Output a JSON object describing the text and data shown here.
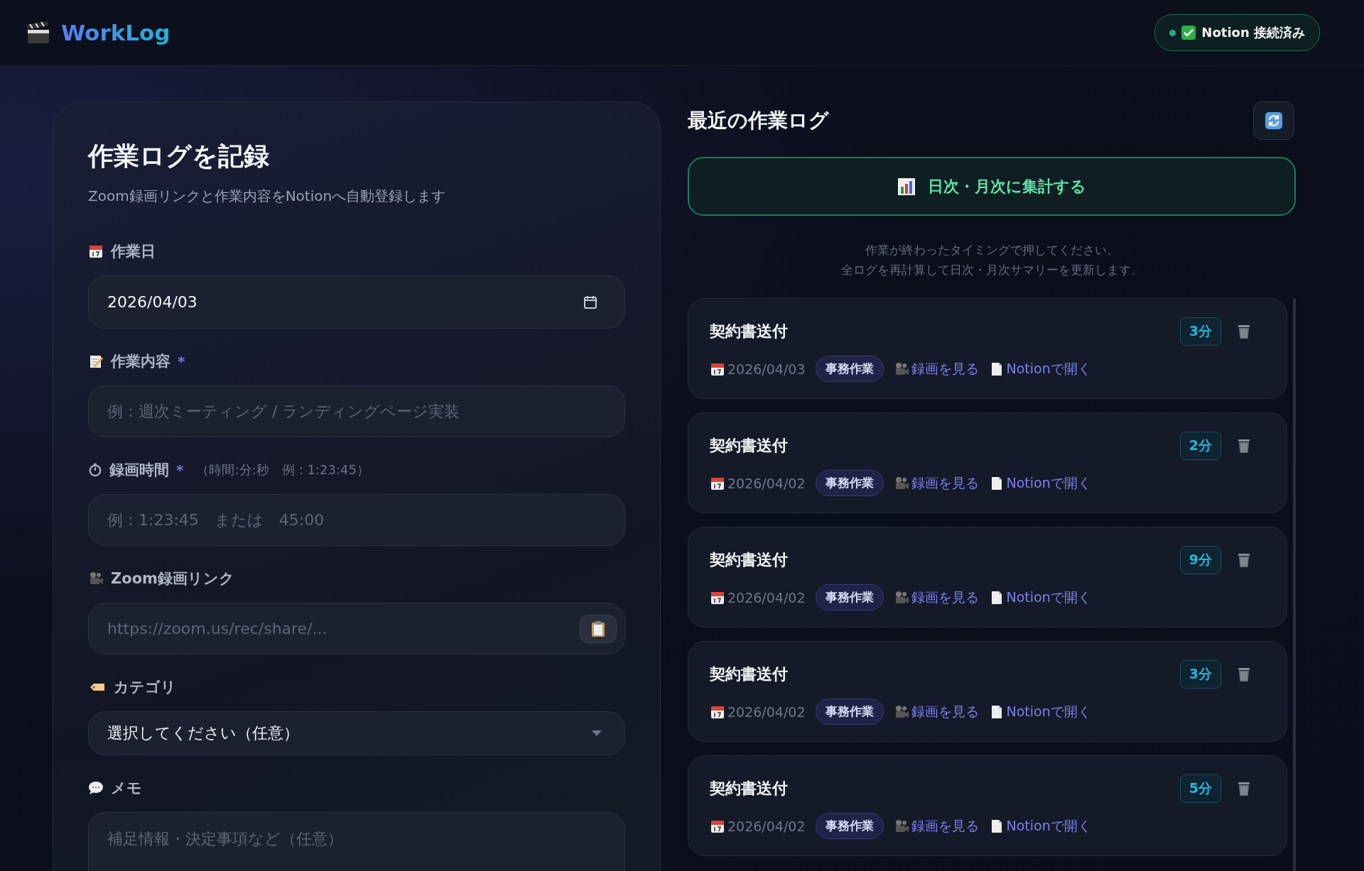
{
  "header": {
    "logo": "WorkLog",
    "status": {
      "label": "Notion 接続済み",
      "connected": true
    }
  },
  "form": {
    "title": "作業ログを記録",
    "subtitle": "Zoom録画リンクと作業内容をNotionへ自動登録します",
    "fields": [
      {
        "kind": "date",
        "label": "作業日",
        "value": "2026/04/03"
      },
      {
        "kind": "text",
        "label": "作業内容",
        "required_mark": "*",
        "placeholder": "例：週次ミーティング / ランディングページ実装"
      },
      {
        "kind": "text",
        "label": "録画時間",
        "required_mark": "*",
        "hint": "（時間:分:秒　例：1:23:45）",
        "placeholder": "例：1:23:45　または　45:00"
      },
      {
        "kind": "url",
        "label": "Zoom録画リンク",
        "placeholder": "https://zoom.us/rec/share/..."
      },
      {
        "kind": "select",
        "label": "カテゴリ",
        "value": "選択してください（任意）"
      },
      {
        "kind": "textarea",
        "label": "メモ",
        "placeholder": "補足情報・決定事項など（任意）"
      }
    ]
  },
  "logs": {
    "title": "最近の作業ログ",
    "aggregate_button": "日次・月次に集計する",
    "note": [
      "作業が終わったタイミングで押してください。",
      "全ログを再計算して日次・月次サマリーを更新します。"
    ],
    "items": [
      {
        "title": "契約書送付",
        "duration": "3分",
        "date": "2026/04/03",
        "category": "事務作業",
        "recording_link": "録画を見る",
        "notion_link": "Notionで開く"
      },
      {
        "title": "契約書送付",
        "duration": "2分",
        "date": "2026/04/02",
        "category": "事務作業",
        "recording_link": "録画を見る",
        "notion_link": "Notionで開く"
      },
      {
        "title": "契約書送付",
        "duration": "9分",
        "date": "2026/04/02",
        "category": "事務作業",
        "recording_link": "録画を見る",
        "notion_link": "Notionで開く"
      },
      {
        "title": "契約書送付",
        "duration": "3分",
        "date": "2026/04/02",
        "category": "事務作業",
        "recording_link": "録画を見る",
        "notion_link": "Notionで開く"
      },
      {
        "title": "契約書送付",
        "duration": "5分",
        "date": "2026/04/02",
        "category": "事務作業",
        "recording_link": "録画を見る",
        "notion_link": "Notionで開く"
      }
    ]
  }
}
